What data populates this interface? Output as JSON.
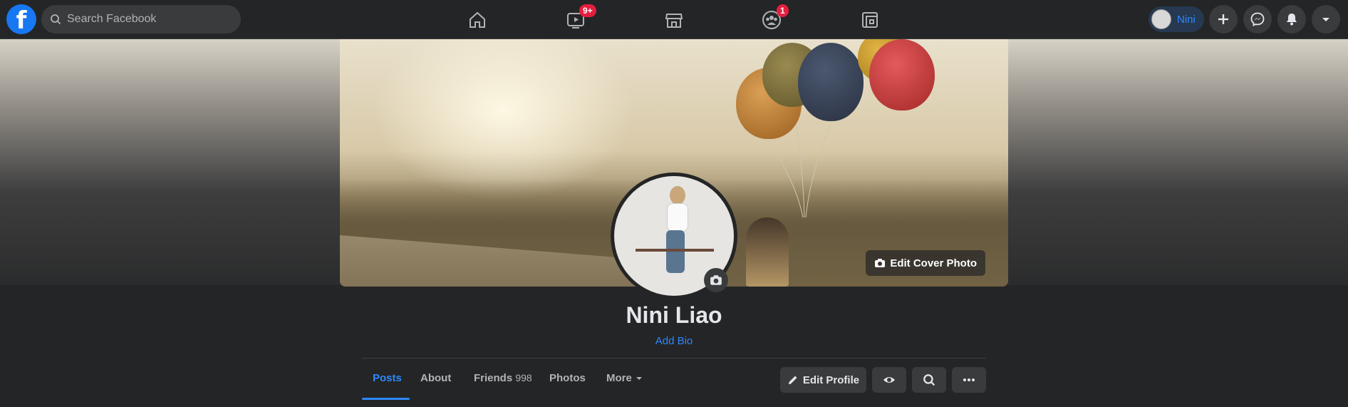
{
  "header": {
    "logo_letter": "f",
    "search": {
      "placeholder": "Search Facebook"
    },
    "nav": [
      {
        "icon": "home-icon"
      },
      {
        "icon": "watch-icon",
        "badge": "9+"
      },
      {
        "icon": "marketplace-icon"
      },
      {
        "icon": "groups-icon",
        "badge": "1"
      },
      {
        "icon": "gaming-icon"
      }
    ],
    "profile_chip": {
      "name": "Nini"
    },
    "actions": [
      "create-icon",
      "messenger-icon",
      "notifications-icon",
      "account-menu-icon"
    ]
  },
  "cover": {
    "edit_label": "Edit Cover Photo"
  },
  "profile": {
    "name": "Nini Liao",
    "bio_link": "Add Bio"
  },
  "tabs": [
    {
      "label": "Posts",
      "active": true
    },
    {
      "label": "About"
    },
    {
      "label": "Friends",
      "count": "998"
    },
    {
      "label": "Photos"
    },
    {
      "label": "More"
    }
  ],
  "profile_actions": {
    "edit_label": "Edit Profile"
  },
  "colors": {
    "accent": "#2d88ff",
    "badge": "#e41e3f",
    "bg": "#18191a",
    "surface": "#242526"
  }
}
